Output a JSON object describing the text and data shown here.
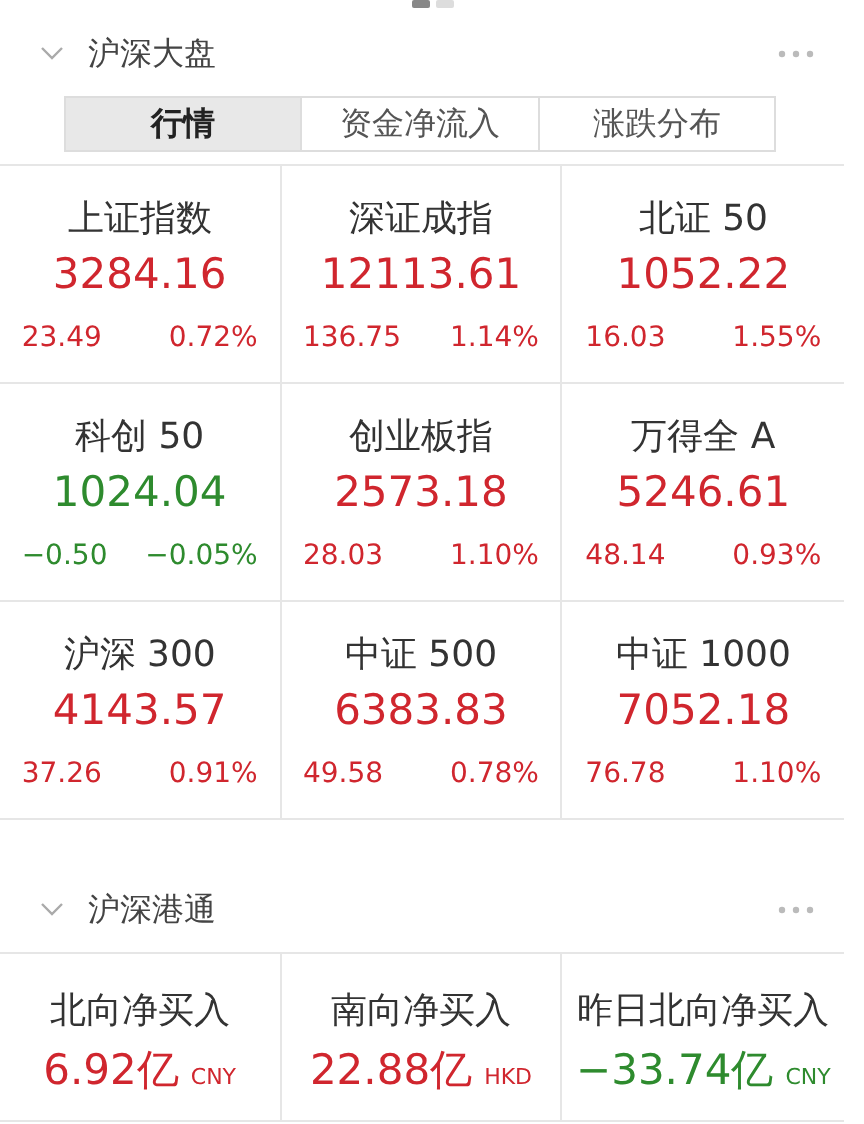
{
  "pager": [
    {
      "selected": true
    },
    {
      "selected": false
    }
  ],
  "sections": [
    {
      "title": "沪深大盘",
      "expanded": true,
      "tabs": [
        {
          "label": "行情",
          "selected": true
        },
        {
          "label": "资金净流入",
          "selected": false
        },
        {
          "label": "涨跌分布",
          "selected": false
        }
      ],
      "tiles": [
        {
          "name": "上证指数",
          "value": "3284.16",
          "change": "23.49",
          "percent": "0.72%",
          "color": "#d0262e"
        },
        {
          "name": "深证成指",
          "value": "12113.61",
          "change": "136.75",
          "percent": "1.14%",
          "color": "#d0262e"
        },
        {
          "name": "北证 50",
          "value": "1052.22",
          "change": "16.03",
          "percent": "1.55%",
          "color": "#d0262e"
        },
        {
          "name": "科创 50",
          "value": "1024.04",
          "change": "−0.50",
          "percent": "−0.05%",
          "color": "#2e8b2e"
        },
        {
          "name": "创业板指",
          "value": "2573.18",
          "change": "28.03",
          "percent": "1.10%",
          "color": "#d0262e"
        },
        {
          "name": "万得全 A",
          "value": "5246.61",
          "change": "48.14",
          "percent": "0.93%",
          "color": "#d0262e"
        },
        {
          "name": "沪深 300",
          "value": "4143.57",
          "change": "37.26",
          "percent": "0.91%",
          "color": "#d0262e"
        },
        {
          "name": "中证 500",
          "value": "6383.83",
          "change": "49.58",
          "percent": "0.78%",
          "color": "#d0262e"
        },
        {
          "name": "中证 1000",
          "value": "7052.18",
          "change": "76.78",
          "percent": "1.10%",
          "color": "#d0262e"
        }
      ]
    },
    {
      "title": "沪深港通",
      "expanded": true,
      "tiles": [
        {
          "name": "北向净买入",
          "value": "6.92亿",
          "unit": "CNY",
          "color": "#d0262e"
        },
        {
          "name": "南向净买入",
          "value": "22.88亿",
          "unit": "HKD",
          "color": "#d0262e"
        },
        {
          "name": "昨日北向净买入",
          "value": "−33.74亿",
          "unit": "CNY",
          "color": "#2e8b2e"
        }
      ]
    }
  ]
}
